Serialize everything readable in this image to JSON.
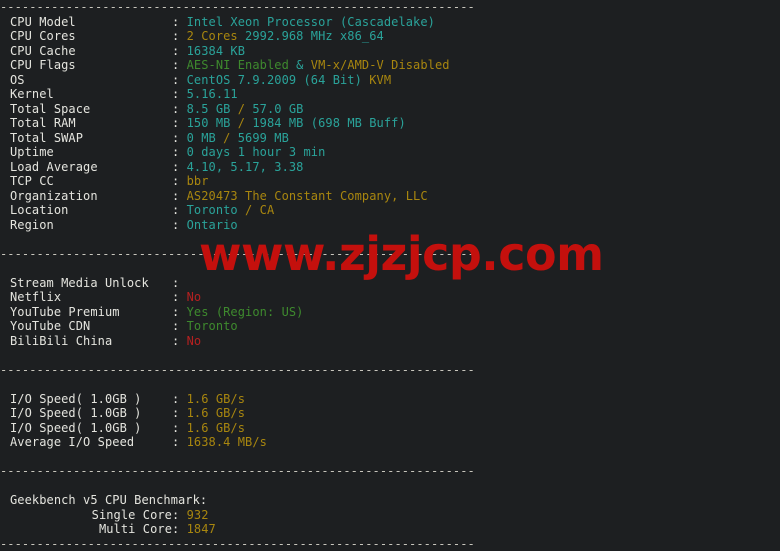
{
  "terminal": {
    "separator": "-----------------------------------------------------------------",
    "watermark": "www.zjzjcp.com",
    "sections": [
      {
        "name": "system-info",
        "rows": [
          {
            "label": "CPU Model",
            "parts": [
              {
                "text": "Intel Xeon Processor (Cascadelake)",
                "color": "cyan"
              }
            ]
          },
          {
            "label": "CPU Cores",
            "parts": [
              {
                "text": "2 Cores ",
                "color": "gold"
              },
              {
                "text": "2992.968 MHz x86_64",
                "color": "cyan"
              }
            ]
          },
          {
            "label": "CPU Cache",
            "parts": [
              {
                "text": "16384 KB",
                "color": "cyan"
              }
            ]
          },
          {
            "label": "CPU Flags",
            "parts": [
              {
                "text": "AES-NI Enabled",
                "color": "green"
              },
              {
                "text": " & ",
                "color": "cyan"
              },
              {
                "text": "VM-x/AMD-V Disabled",
                "color": "gold"
              }
            ]
          },
          {
            "label": "OS",
            "parts": [
              {
                "text": "CentOS 7.9.2009 (64 Bit) ",
                "color": "cyan"
              },
              {
                "text": "KVM",
                "color": "gold"
              }
            ]
          },
          {
            "label": "Kernel",
            "parts": [
              {
                "text": "5.16.11",
                "color": "cyan"
              }
            ]
          },
          {
            "label": "Total Space",
            "parts": [
              {
                "text": "8.5 GB ",
                "color": "cyan"
              },
              {
                "text": "/ ",
                "color": "gold"
              },
              {
                "text": "57.0 GB",
                "color": "cyan"
              }
            ]
          },
          {
            "label": "Total RAM",
            "parts": [
              {
                "text": "150 MB ",
                "color": "cyan"
              },
              {
                "text": "/ ",
                "color": "gold"
              },
              {
                "text": "1984 MB ",
                "color": "cyan"
              },
              {
                "text": "(698 MB Buff)",
                "color": "cyan"
              }
            ]
          },
          {
            "label": "Total SWAP",
            "parts": [
              {
                "text": "0 MB ",
                "color": "cyan"
              },
              {
                "text": "/ ",
                "color": "gold"
              },
              {
                "text": "5699 MB",
                "color": "cyan"
              }
            ]
          },
          {
            "label": "Uptime",
            "parts": [
              {
                "text": "0 days 1 hour 3 min",
                "color": "cyan"
              }
            ]
          },
          {
            "label": "Load Average",
            "parts": [
              {
                "text": "4.10, 5.17, 3.38",
                "color": "cyan"
              }
            ]
          },
          {
            "label": "TCP CC",
            "parts": [
              {
                "text": "bbr",
                "color": "gold"
              }
            ]
          },
          {
            "label": "Organization",
            "parts": [
              {
                "text": "AS20473 The Constant Company, LLC",
                "color": "gold"
              }
            ]
          },
          {
            "label": "Location",
            "parts": [
              {
                "text": "Toronto ",
                "color": "cyan"
              },
              {
                "text": "/ ",
                "color": "gold"
              },
              {
                "text": "CA",
                "color": "gold"
              }
            ]
          },
          {
            "label": "Region",
            "parts": [
              {
                "text": "Ontario",
                "color": "cyan"
              }
            ]
          }
        ]
      },
      {
        "name": "stream-media-unlock",
        "rows": [
          {
            "label": "Stream Media Unlock",
            "parts": []
          },
          {
            "label": "Netflix",
            "parts": [
              {
                "text": "No",
                "color": "red"
              }
            ]
          },
          {
            "label": "YouTube Premium",
            "parts": [
              {
                "text": "Yes (Region: US)",
                "color": "green"
              }
            ]
          },
          {
            "label": "YouTube CDN",
            "parts": [
              {
                "text": "Toronto",
                "color": "green"
              }
            ]
          },
          {
            "label": "BiliBili China",
            "parts": [
              {
                "text": "No",
                "color": "red"
              }
            ]
          }
        ]
      },
      {
        "name": "io-speed",
        "rows": [
          {
            "label": "I/O Speed( 1.0GB )",
            "parts": [
              {
                "text": "1.6 GB/s",
                "color": "gold"
              }
            ]
          },
          {
            "label": "I/O Speed( 1.0GB )",
            "parts": [
              {
                "text": "1.6 GB/s",
                "color": "gold"
              }
            ]
          },
          {
            "label": "I/O Speed( 1.0GB )",
            "parts": [
              {
                "text": "1.6 GB/s",
                "color": "gold"
              }
            ]
          },
          {
            "label": "Average I/O Speed",
            "parts": [
              {
                "text": "1638.4 MB/s",
                "color": "gold"
              }
            ]
          }
        ]
      },
      {
        "name": "geekbench",
        "heading": "Geekbench v5 CPU Benchmark:",
        "rows": [
          {
            "label": "Single Core",
            "indent": true,
            "parts": [
              {
                "text": "932",
                "color": "gold"
              }
            ]
          },
          {
            "label": "Multi Core",
            "indent": true,
            "parts": [
              {
                "text": "1847",
                "color": "gold"
              }
            ]
          }
        ]
      }
    ]
  }
}
